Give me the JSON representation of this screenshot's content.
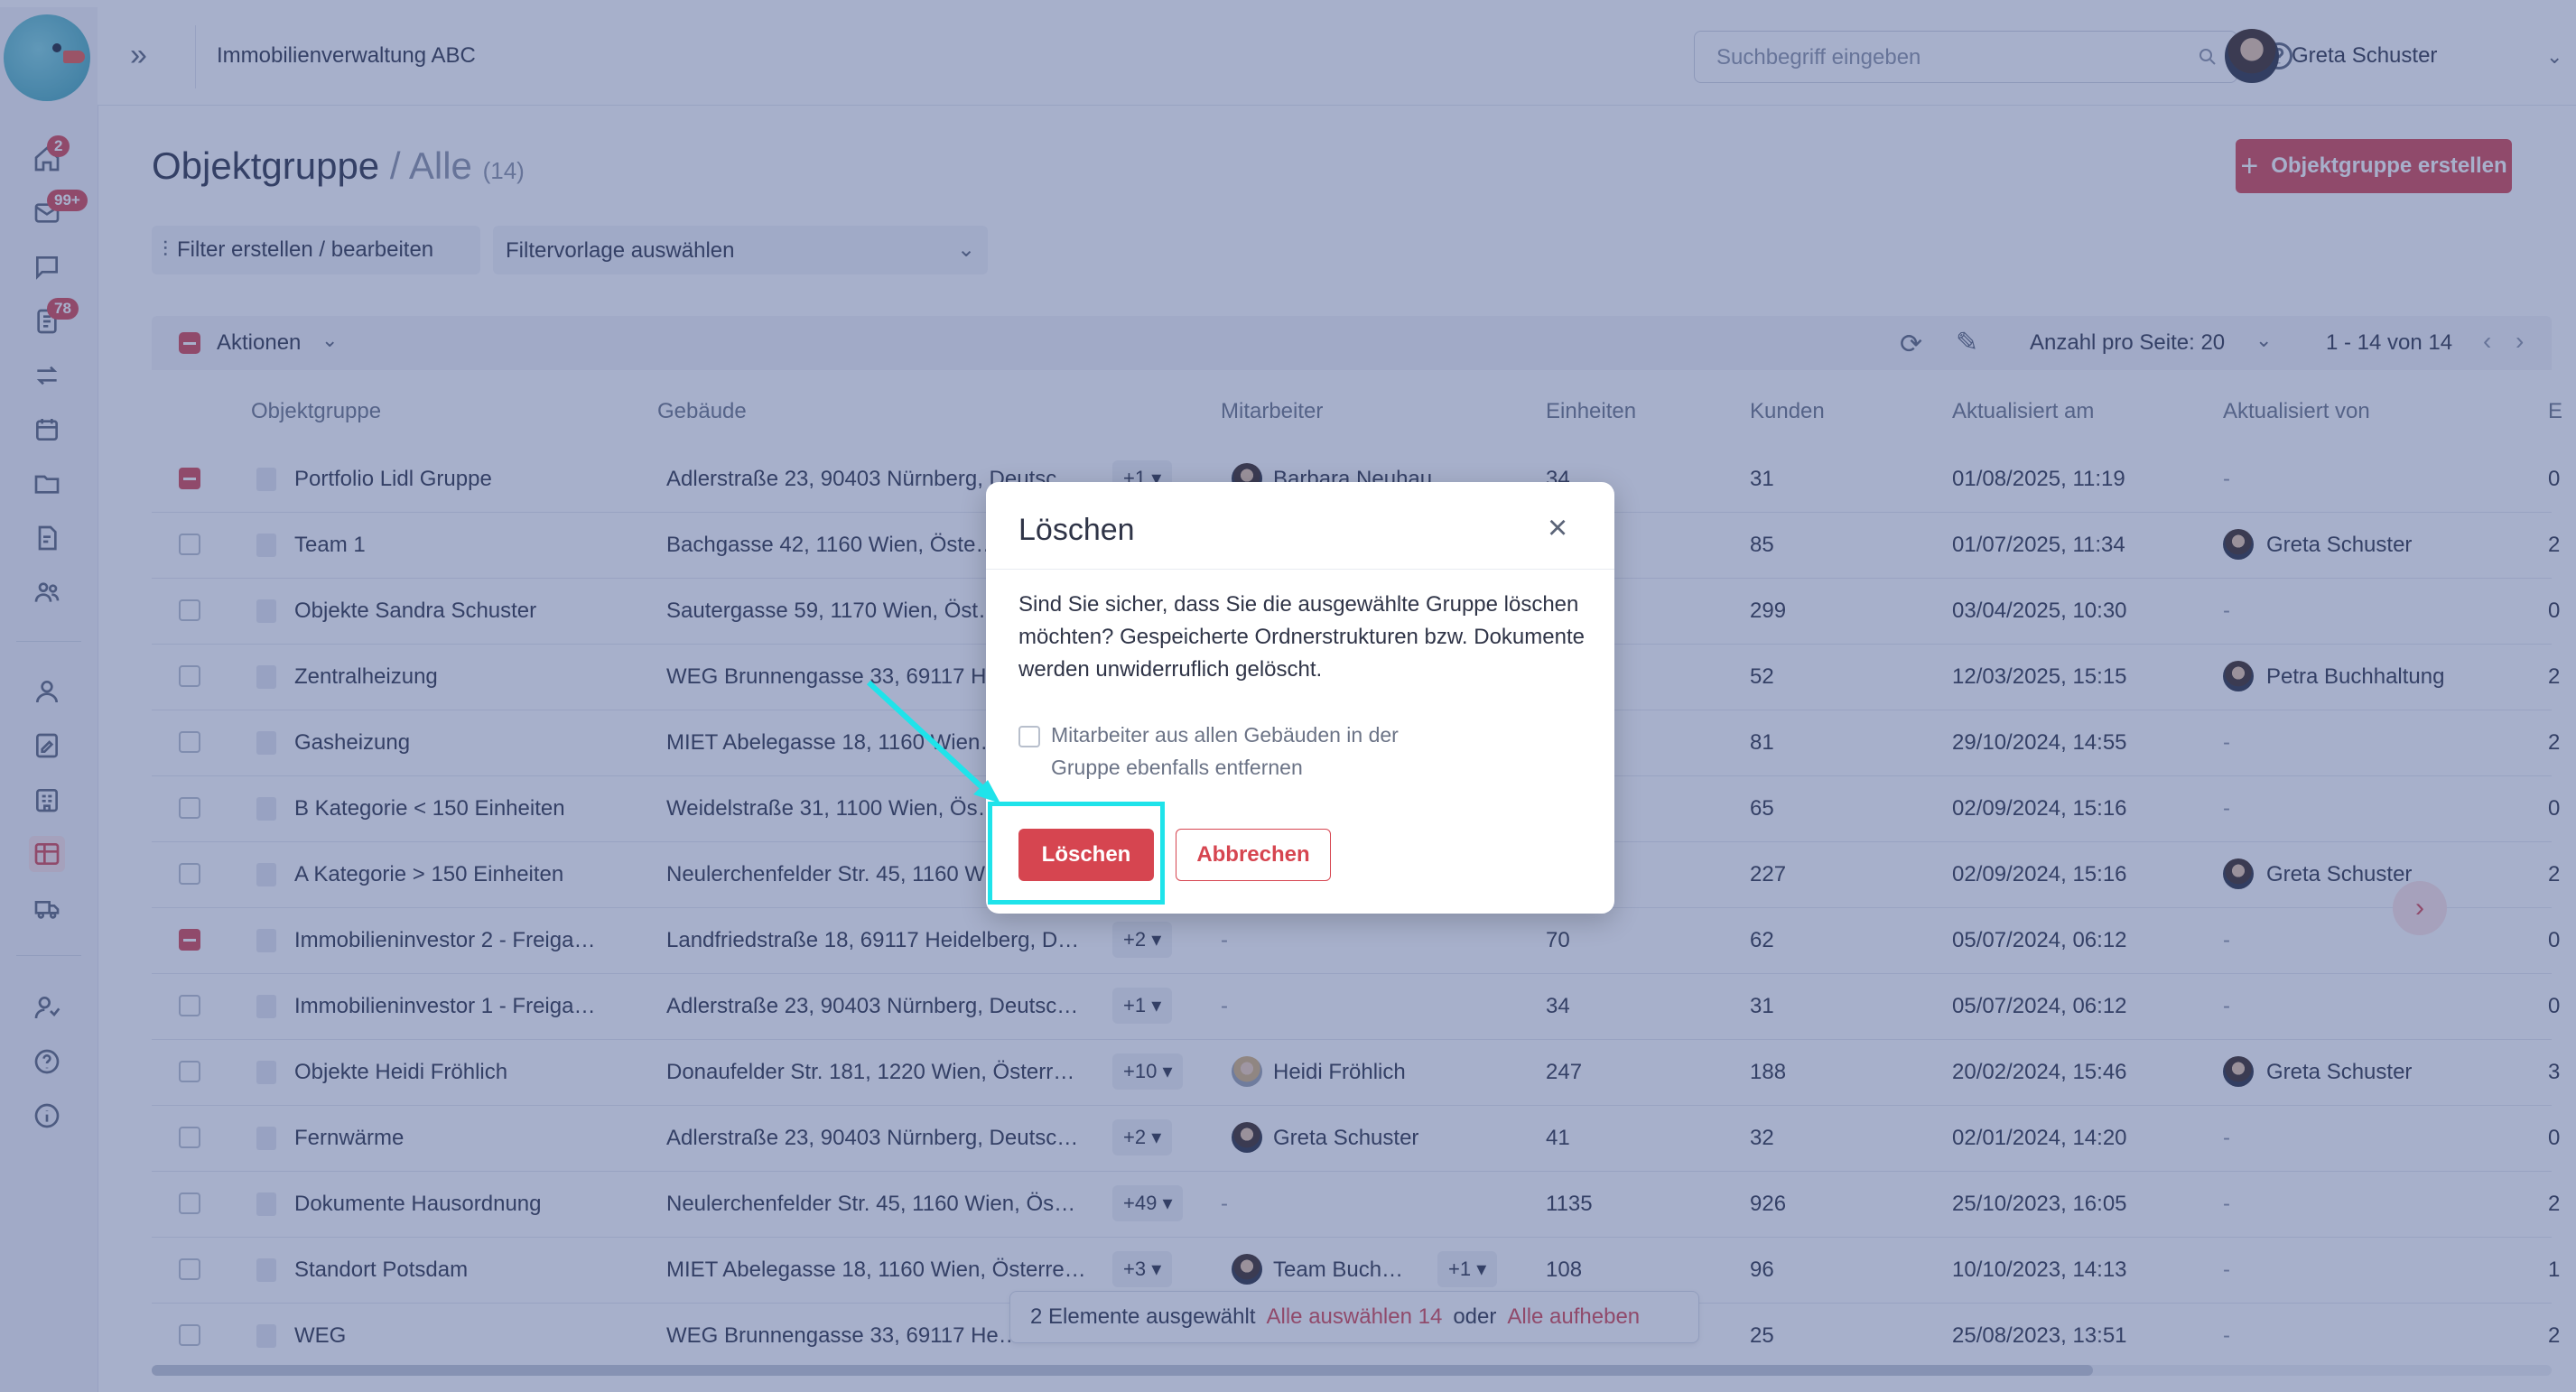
{
  "app": {
    "title": "Immobilienverwaltung ABC"
  },
  "search": {
    "placeholder": "Suchbegriff eingeben"
  },
  "user": {
    "name": "Greta Schuster"
  },
  "sidebar": {
    "badges": {
      "home": "2",
      "mail": "99+",
      "tasks": "78"
    }
  },
  "page": {
    "title": "Objektgruppe",
    "separator": "/",
    "subtitle": "Alle",
    "count": "(14)",
    "create_label": "Objektgruppe erstellen",
    "filter_label": "Filter erstellen / bearbeiten",
    "filter_template": "Filtervorlage auswählen"
  },
  "toolbar": {
    "actions_label": "Aktionen",
    "per_page_label": "Anzahl pro Seite:",
    "per_page_value": "20",
    "range": "1 - 14 von 14"
  },
  "columns": [
    "Objektgruppe",
    "Gebäude",
    "Mitarbeiter",
    "Einheiten",
    "Kunden",
    "Aktualisiert am",
    "Aktualisiert von",
    "E"
  ],
  "rows": [
    {
      "checked": true,
      "name": "Portfolio Lidl Gruppe",
      "building": "Adlerstraße 23, 90403 Nürnberg, Deutsc…",
      "more": "+1",
      "staff": "Barbara Neuhauser",
      "staff_more": "",
      "units": "34",
      "customers": "31",
      "updated": "01/08/2025, 11:19",
      "updated_by": "-",
      "e": "0"
    },
    {
      "checked": false,
      "name": "Team 1",
      "building": "Bachgasse 42, 1160 Wien, Öste…",
      "more": "",
      "staff": "",
      "staff_more": "",
      "units": "",
      "customers": "85",
      "updated": "01/07/2025, 11:34",
      "updated_by": "Greta Schuster",
      "e": "2"
    },
    {
      "checked": false,
      "name": "Objekte Sandra Schuster",
      "building": "Sautergasse 59, 1170 Wien, Öst…",
      "more": "",
      "staff": "",
      "staff_more": "",
      "units": "",
      "customers": "299",
      "updated": "03/04/2025, 10:30",
      "updated_by": "-",
      "e": "0"
    },
    {
      "checked": false,
      "name": "Zentralheizung",
      "building": "WEG Brunnengasse 33, 69117 H…",
      "more": "",
      "staff": "",
      "staff_more": "",
      "units": "",
      "customers": "52",
      "updated": "12/03/2025, 15:15",
      "updated_by": "Petra Buchhaltung",
      "e": "2"
    },
    {
      "checked": false,
      "name": "Gasheizung",
      "building": "MIET Abelegasse 18, 1160 Wien…",
      "more": "",
      "staff": "",
      "staff_more": "",
      "units": "",
      "customers": "81",
      "updated": "29/10/2024, 14:55",
      "updated_by": "-",
      "e": "2"
    },
    {
      "checked": false,
      "name": "B Kategorie < 150 Einheiten",
      "building": "Weidelstraße 31, 1100 Wien, Ös…",
      "more": "",
      "staff": "",
      "staff_more": "",
      "units": "",
      "customers": "65",
      "updated": "02/09/2024, 15:16",
      "updated_by": "-",
      "e": "0"
    },
    {
      "checked": false,
      "name": "A Kategorie > 150 Einheiten",
      "building": "Neulerchenfelder Str. 45, 1160 W…",
      "more": "",
      "staff": "",
      "staff_more": "",
      "units": "",
      "customers": "227",
      "updated": "02/09/2024, 15:16",
      "updated_by": "Greta Schuster",
      "e": "2"
    },
    {
      "checked": true,
      "name": "Immobilieninvestor 2 - Freiga…",
      "building": "Landfriedstraße 18, 69117 Heidelberg, D…",
      "more": "+2",
      "staff": "-",
      "staff_more": "",
      "units": "70",
      "customers": "62",
      "updated": "05/07/2024, 06:12",
      "updated_by": "-",
      "e": "0"
    },
    {
      "checked": false,
      "name": "Immobilieninvestor 1 - Freiga…",
      "building": "Adlerstraße 23, 90403 Nürnberg, Deutsc…",
      "more": "+1",
      "staff": "-",
      "staff_more": "",
      "units": "34",
      "customers": "31",
      "updated": "05/07/2024, 06:12",
      "updated_by": "-",
      "e": "0"
    },
    {
      "checked": false,
      "name": "Objekte Heidi Fröhlich",
      "building": "Donaufelder Str. 181, 1220 Wien, Österr…",
      "more": "+10",
      "staff": "Heidi Fröhlich",
      "staff_more": "",
      "units": "247",
      "customers": "188",
      "updated": "20/02/2024, 15:46",
      "updated_by": "Greta Schuster",
      "e": "3"
    },
    {
      "checked": false,
      "name": "Fernwärme",
      "building": "Adlerstraße 23, 90403 Nürnberg, Deutsc…",
      "more": "+2",
      "staff": "Greta Schuster",
      "staff_more": "",
      "units": "41",
      "customers": "32",
      "updated": "02/01/2024, 14:20",
      "updated_by": "-",
      "e": "0"
    },
    {
      "checked": false,
      "name": "Dokumente Hausordnung",
      "building": "Neulerchenfelder Str. 45, 1160 Wien, Ös…",
      "more": "+49",
      "staff": "-",
      "staff_more": "",
      "units": "1135",
      "customers": "926",
      "updated": "25/10/2023, 16:05",
      "updated_by": "-",
      "e": "2"
    },
    {
      "checked": false,
      "name": "Standort Potsdam",
      "building": "MIET Abelegasse 18, 1160 Wien, Österre…",
      "more": "+3",
      "staff": "Team Buch…",
      "staff_more": "+1",
      "units": "108",
      "customers": "96",
      "updated": "10/10/2023, 14:13",
      "updated_by": "-",
      "e": "1"
    },
    {
      "checked": false,
      "name": "WEG",
      "building": "WEG Brunnengasse 33, 69117 He…",
      "more": "",
      "staff": "",
      "staff_more": "",
      "units": "",
      "customers": "25",
      "updated": "25/08/2023, 13:51",
      "updated_by": "-",
      "e": "2"
    }
  ],
  "selection_bar": {
    "text": "2 Elemente ausgewählt",
    "select_all": "Alle auswählen 14",
    "or": "oder",
    "deselect": "Alle aufheben"
  },
  "modal": {
    "title": "Löschen",
    "text": "Sind Sie sicher, dass Sie die ausgewählte Gruppe löschen möchten? Gespeicherte Ordnerstrukturen bzw. Dokumente werden unwiderruflich gelöscht.",
    "checkbox_label": "Mitarbeiter aus allen Gebäuden in der Gruppe ebenfalls entfernen",
    "delete_label": "Löschen",
    "cancel_label": "Abbrechen"
  },
  "colors": {
    "accent": "#d64550",
    "highlight": "#1fe3ea",
    "overlay": "#3c508c"
  }
}
